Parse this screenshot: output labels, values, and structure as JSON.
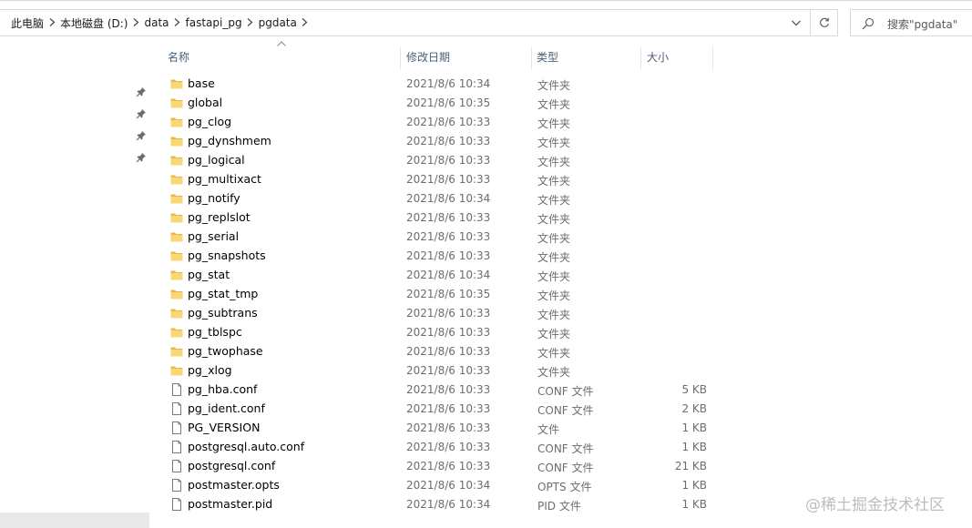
{
  "address_bar": {
    "breadcrumb": [
      "此电脑",
      "本地磁盘 (D:)",
      "data",
      "fastapi_pg",
      "pgdata"
    ]
  },
  "search": {
    "placeholder": "搜索\"pgdata\""
  },
  "columns": {
    "name": "名称",
    "date": "修改日期",
    "type": "类型",
    "size": "大小"
  },
  "files": [
    {
      "name": "base",
      "date": "2021/8/6 10:34",
      "type": "文件夹",
      "size": "",
      "kind": "folder"
    },
    {
      "name": "global",
      "date": "2021/8/6 10:35",
      "type": "文件夹",
      "size": "",
      "kind": "folder"
    },
    {
      "name": "pg_clog",
      "date": "2021/8/6 10:33",
      "type": "文件夹",
      "size": "",
      "kind": "folder"
    },
    {
      "name": "pg_dynshmem",
      "date": "2021/8/6 10:33",
      "type": "文件夹",
      "size": "",
      "kind": "folder"
    },
    {
      "name": "pg_logical",
      "date": "2021/8/6 10:33",
      "type": "文件夹",
      "size": "",
      "kind": "folder"
    },
    {
      "name": "pg_multixact",
      "date": "2021/8/6 10:33",
      "type": "文件夹",
      "size": "",
      "kind": "folder"
    },
    {
      "name": "pg_notify",
      "date": "2021/8/6 10:34",
      "type": "文件夹",
      "size": "",
      "kind": "folder"
    },
    {
      "name": "pg_replslot",
      "date": "2021/8/6 10:33",
      "type": "文件夹",
      "size": "",
      "kind": "folder"
    },
    {
      "name": "pg_serial",
      "date": "2021/8/6 10:33",
      "type": "文件夹",
      "size": "",
      "kind": "folder"
    },
    {
      "name": "pg_snapshots",
      "date": "2021/8/6 10:33",
      "type": "文件夹",
      "size": "",
      "kind": "folder"
    },
    {
      "name": "pg_stat",
      "date": "2021/8/6 10:34",
      "type": "文件夹",
      "size": "",
      "kind": "folder"
    },
    {
      "name": "pg_stat_tmp",
      "date": "2021/8/6 10:35",
      "type": "文件夹",
      "size": "",
      "kind": "folder"
    },
    {
      "name": "pg_subtrans",
      "date": "2021/8/6 10:33",
      "type": "文件夹",
      "size": "",
      "kind": "folder"
    },
    {
      "name": "pg_tblspc",
      "date": "2021/8/6 10:33",
      "type": "文件夹",
      "size": "",
      "kind": "folder"
    },
    {
      "name": "pg_twophase",
      "date": "2021/8/6 10:33",
      "type": "文件夹",
      "size": "",
      "kind": "folder"
    },
    {
      "name": "pg_xlog",
      "date": "2021/8/6 10:33",
      "type": "文件夹",
      "size": "",
      "kind": "folder"
    },
    {
      "name": "pg_hba.conf",
      "date": "2021/8/6 10:33",
      "type": "CONF 文件",
      "size": "5 KB",
      "kind": "file"
    },
    {
      "name": "pg_ident.conf",
      "date": "2021/8/6 10:33",
      "type": "CONF 文件",
      "size": "2 KB",
      "kind": "file"
    },
    {
      "name": "PG_VERSION",
      "date": "2021/8/6 10:33",
      "type": "文件",
      "size": "1 KB",
      "kind": "file"
    },
    {
      "name": "postgresql.auto.conf",
      "date": "2021/8/6 10:33",
      "type": "CONF 文件",
      "size": "1 KB",
      "kind": "file"
    },
    {
      "name": "postgresql.conf",
      "date": "2021/8/6 10:33",
      "type": "CONF 文件",
      "size": "21 KB",
      "kind": "file"
    },
    {
      "name": "postmaster.opts",
      "date": "2021/8/6 10:34",
      "type": "OPTS 文件",
      "size": "1 KB",
      "kind": "file"
    },
    {
      "name": "postmaster.pid",
      "date": "2021/8/6 10:34",
      "type": "PID 文件",
      "size": "1 KB",
      "kind": "file"
    }
  ],
  "watermark": "@稀土掘金技术社区",
  "icons": {
    "folder": "folder-icon",
    "file": "file-icon",
    "pin": "pin-icon",
    "search": "search-icon",
    "refresh": "refresh-icon",
    "dropdown": "chevron-down-icon",
    "separator": "chevron-right-icon",
    "sort": "sort-up-icon"
  },
  "colors": {
    "folder_fill": "#f8d775",
    "folder_tab": "#e8b94a",
    "header_text": "#4c607a"
  }
}
